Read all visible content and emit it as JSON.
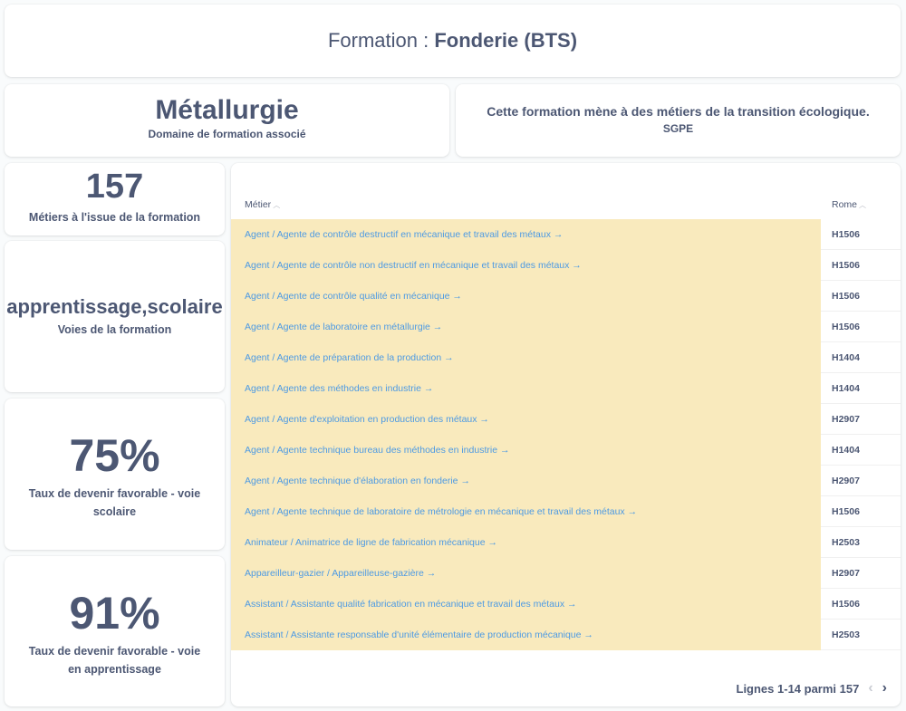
{
  "header": {
    "prefix": "Formation :",
    "name": "Fonderie (BTS)"
  },
  "domain": {
    "value": "Métallurgie",
    "label": "Domaine de formation associé"
  },
  "transition": {
    "text": "Cette formation mène à des métiers de la transition écologique.",
    "label": "SGPE"
  },
  "stats": {
    "metiers": {
      "value": "157",
      "label": "Métiers à l'issue de la formation"
    },
    "voies": {
      "value": "apprentissage,scolaire",
      "label": "Voies de la formation"
    },
    "scolaire": {
      "value": "75%",
      "label": "Taux de devenir favorable - voie scolaire"
    },
    "apprentissage": {
      "value": "91%",
      "label": "Taux de devenir favorable - voie en apprentissage"
    }
  },
  "table": {
    "columns": {
      "metier": "Métier",
      "rome": "Rome"
    },
    "sort_icon": "chevron-up-icon",
    "rows": [
      {
        "metier": "Agent / Agente de contrôle destructif en mécanique et travail des métaux →",
        "rome": "H1506"
      },
      {
        "metier": "Agent / Agente de contrôle non destructif en mécanique et travail des métaux →",
        "rome": "H1506"
      },
      {
        "metier": "Agent / Agente de contrôle qualité en mécanique →",
        "rome": "H1506"
      },
      {
        "metier": "Agent / Agente de laboratoire en métallurgie →",
        "rome": "H1506"
      },
      {
        "metier": "Agent / Agente de préparation de la production →",
        "rome": "H1404"
      },
      {
        "metier": "Agent / Agente des méthodes en industrie →",
        "rome": "H1404"
      },
      {
        "metier": "Agent / Agente d'exploitation en production des métaux →",
        "rome": "H2907"
      },
      {
        "metier": "Agent / Agente technique bureau des méthodes en industrie →",
        "rome": "H1404"
      },
      {
        "metier": "Agent / Agente technique d'élaboration en fonderie →",
        "rome": "H2907"
      },
      {
        "metier": "Agent / Agente technique de laboratoire de métrologie en mécanique et travail des métaux →",
        "rome": "H1506"
      },
      {
        "metier": "Animateur / Animatrice de ligne de fabrication mécanique →",
        "rome": "H2503"
      },
      {
        "metier": "Appareilleur-gazier / Appareilleuse-gazière →",
        "rome": "H2907"
      },
      {
        "metier": "Assistant / Assistante qualité fabrication en mécanique et travail des métaux →",
        "rome": "H1506"
      },
      {
        "metier": "Assistant / Assistante responsable d'unité élémentaire de production mécanique →",
        "rome": "H2503"
      }
    ],
    "pagination": {
      "text": "Lignes 1-14 parmi 157",
      "prev_icon": "chevron-left-icon",
      "next_icon": "chevron-right-icon"
    }
  },
  "colors": {
    "text": "#4c5773",
    "link": "#4d9ae3",
    "highlight": "#f9eabd",
    "background": "#f9fbfc"
  }
}
